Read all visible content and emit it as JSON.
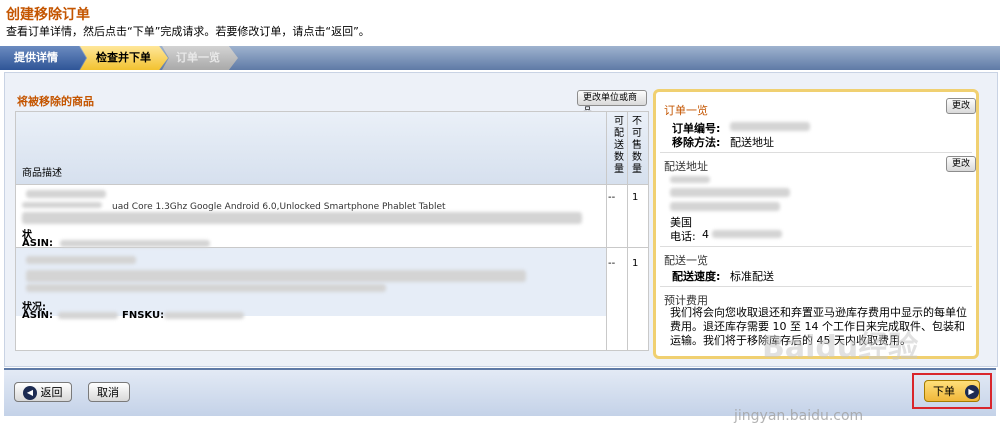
{
  "header": {
    "title": "创建移除订单",
    "instructions": "查看订单详情，然后点击“下单”完成请求。若要修改订单，请点击“返回”。"
  },
  "steps": [
    {
      "label": "提供详情",
      "state": "done"
    },
    {
      "label": "检查并下单",
      "state": "current"
    },
    {
      "label": "订单一览",
      "state": "upcoming"
    }
  ],
  "products": {
    "title": "将被移除的商品",
    "change_button": "更改单位或商品",
    "columns": {
      "description": "商品描述",
      "removable_qty": "可配送数量",
      "unsellable_qty": "不可售数量"
    },
    "rows": [
      {
        "desc_line": "uad Core 1.3Ghz Google Android 6.0,Unlocked Smartphone Phablet Tablet",
        "condition_label": "状",
        "asin_label": "ASIN:",
        "removable": "--",
        "unsellable": "1"
      },
      {
        "condition_label": "状况:",
        "asin_label": "ASIN:",
        "fnsku_label": "FNSKU:",
        "removable": "--",
        "unsellable": "1"
      }
    ]
  },
  "summary": {
    "title": "订单一览",
    "change_button": "更改",
    "order_number_label": "订单编号:",
    "removal_method_label": "移除方法:",
    "removal_method_value": "配送地址",
    "address_title": "配送地址",
    "address_change_button": "更改",
    "address_country": "美国",
    "phone_label": "电话:",
    "phone_partial": "4",
    "shipping_title": "配送一览",
    "shipping_speed_label": "配送速度:",
    "shipping_speed_value": "标准配送",
    "fee_title": "预计费用",
    "fee_text": "我们将会向您收取退还和弃置亚马逊库存费用中显示的每单位费用。退还库存需要 10 至 14 个工作日来完成取件、包装和运输。我们将于移除库存后的 45 天内收取费用。"
  },
  "footer": {
    "back_label": "返回",
    "cancel_label": "取消",
    "submit_label": "下单"
  },
  "watermark": {
    "brand": "Baidu经验",
    "url": "jingyan.baidu.com"
  },
  "colors": {
    "accent": "#c45500",
    "nav_blue": "#2f5597",
    "highlight_red": "#d9262c"
  }
}
